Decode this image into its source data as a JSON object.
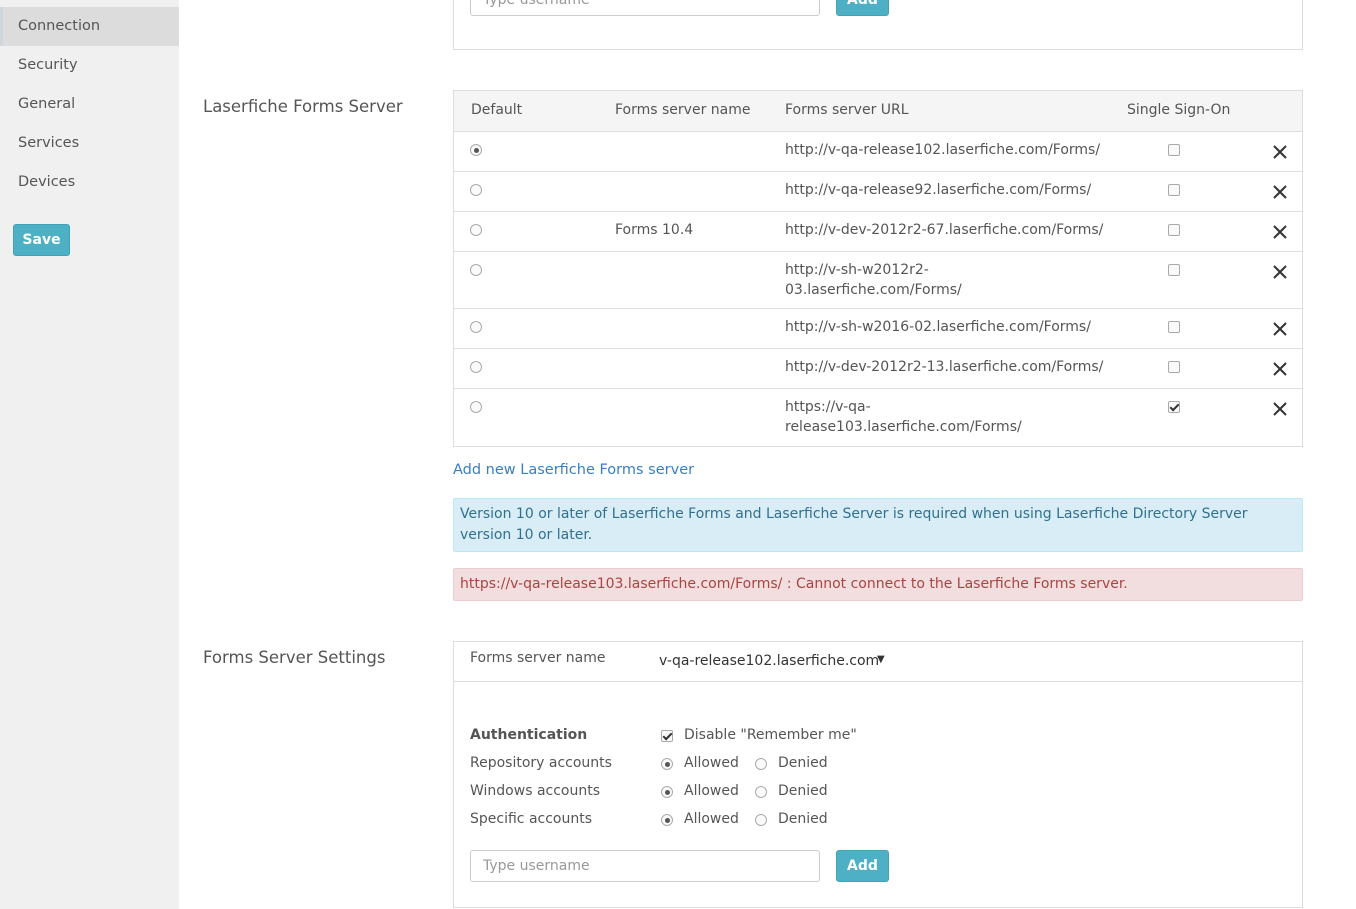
{
  "sidebar": {
    "items": [
      {
        "label": "Connection"
      },
      {
        "label": "Security"
      },
      {
        "label": "General"
      },
      {
        "label": "Services"
      },
      {
        "label": "Devices"
      }
    ],
    "save_label": "Save"
  },
  "top_panel": {
    "username_placeholder": "Type username",
    "add_label": "Add"
  },
  "forms_server": {
    "title": "Laserfiche Forms Server",
    "columns": [
      "Default",
      "Forms server name",
      "Forms server URL",
      "Single Sign-On"
    ],
    "rows": [
      {
        "default": true,
        "name": "",
        "url_lines": [
          "http://v-qa-release102.laserfiche.com/Forms/"
        ],
        "sso": false
      },
      {
        "default": false,
        "name": "",
        "url_lines": [
          "http://v-qa-release92.laserfiche.com/Forms/"
        ],
        "sso": false
      },
      {
        "default": false,
        "name": "Forms 10.4",
        "url_lines": [
          "http://v-dev-2012r2-67.laserfiche.com/Forms/"
        ],
        "sso": false
      },
      {
        "default": false,
        "name": "",
        "url_lines": [
          "http://v-sh-w2012r2-",
          "03.laserfiche.com/Forms/"
        ],
        "sso": false
      },
      {
        "default": false,
        "name": "",
        "url_lines": [
          "http://v-sh-w2016-02.laserfiche.com/Forms/"
        ],
        "sso": false
      },
      {
        "default": false,
        "name": "",
        "url_lines": [
          "http://v-dev-2012r2-13.laserfiche.com/Forms/"
        ],
        "sso": false
      },
      {
        "default": false,
        "name": "",
        "url_lines": [
          "https://v-qa-",
          "release103.laserfiche.com/Forms/"
        ],
        "sso": true
      }
    ],
    "add_link": "Add new Laserfiche Forms server",
    "info_alert": "Version 10 or later of Laserfiche Forms and Laserfiche Server is required when using Laserfiche Directory Server version 10 or later.",
    "error_alert": "https://v-qa-release103.laserfiche.com/Forms/ : Cannot connect to the Laserfiche Forms server."
  },
  "settings": {
    "title": "Forms Server Settings",
    "server_name_label": "Forms server name",
    "server_name_value": "v-qa-release102.laserfiche.com",
    "authentication_label": "Authentication",
    "disable_remember_me": "Disable \"Remember me\"",
    "disable_remember_me_checked": true,
    "allowed_label": "Allowed",
    "denied_label": "Denied",
    "account_rows": [
      {
        "label": "Repository accounts",
        "allowed": true
      },
      {
        "label": "Windows accounts",
        "allowed": true
      },
      {
        "label": "Specific accounts",
        "allowed": true
      }
    ],
    "username_placeholder": "Type username",
    "add_label": "Add"
  },
  "colors": {
    "accent": "#4db0c4",
    "link": "#3a7fbf",
    "info_bg": "#d9edf7",
    "danger_bg": "#f2dede"
  },
  "icons": {
    "delete": "close-icon",
    "select": "caret-down-icon"
  }
}
